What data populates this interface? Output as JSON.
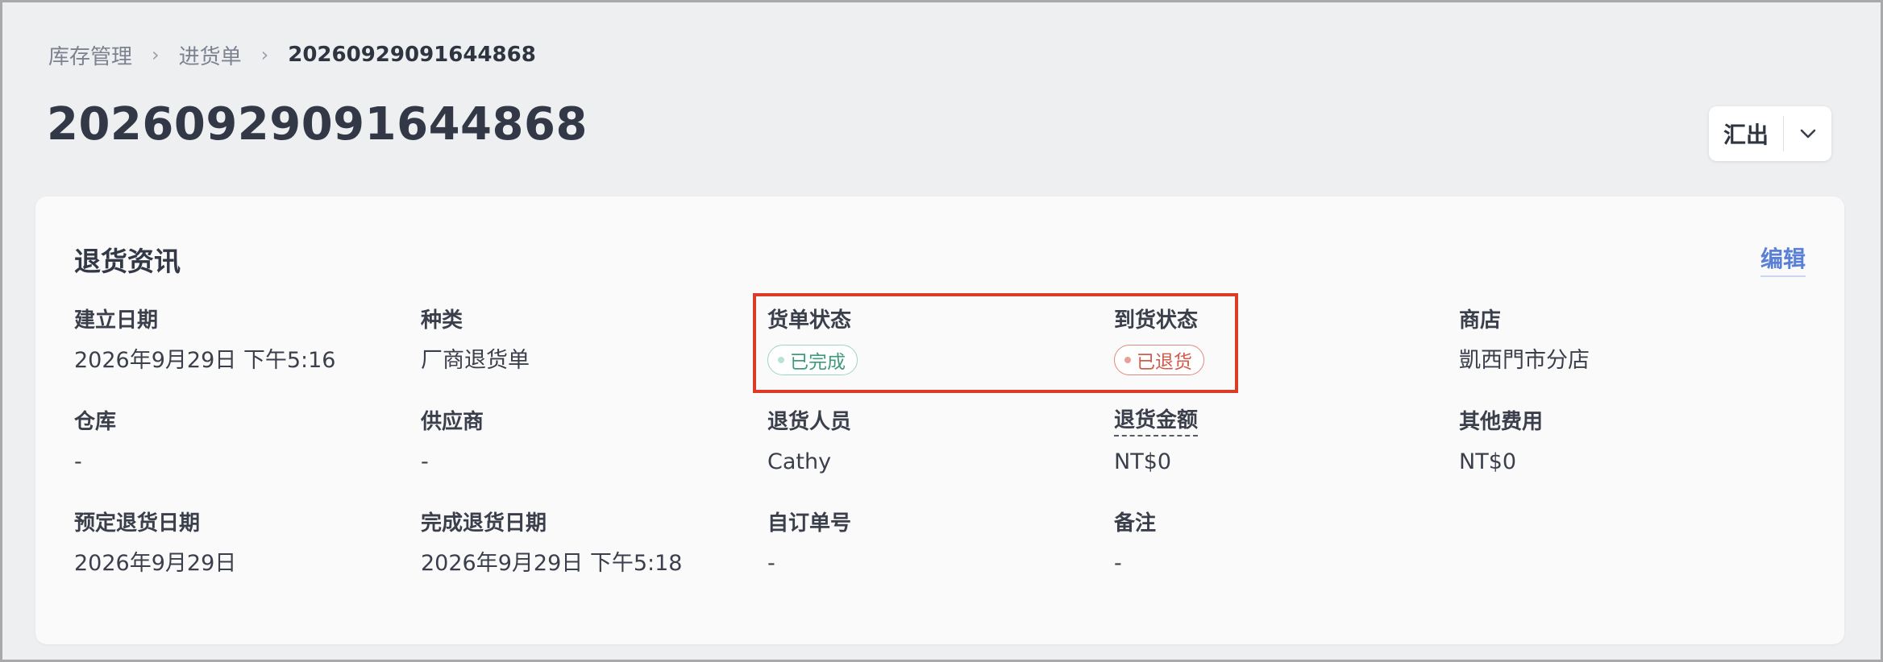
{
  "breadcrumb": {
    "items": [
      "库存管理",
      "进货单"
    ],
    "current": "20260929091644868",
    "separator": "›"
  },
  "page_title": "20260929091644868",
  "export": {
    "label": "汇出",
    "dropdown_icon": "chevron-down-icon"
  },
  "card": {
    "title": "退货资讯",
    "edit_label": "编辑",
    "fields": {
      "created_date": {
        "label": "建立日期",
        "value": "2026年9月29日 下午5:16"
      },
      "type": {
        "label": "种类",
        "value": "厂商退货单"
      },
      "order_status": {
        "label": "货单状态",
        "value": "已完成",
        "color": "#3f9b7a"
      },
      "arrival_status": {
        "label": "到货状态",
        "value": "已退货",
        "color": "#d25b4b"
      },
      "store": {
        "label": "商店",
        "value": "凱西門市分店"
      },
      "warehouse": {
        "label": "仓库",
        "value": "-"
      },
      "supplier": {
        "label": "供应商",
        "value": "-"
      },
      "return_staff": {
        "label": "退货人员",
        "value": "Cathy"
      },
      "return_amount": {
        "label": "退货金额",
        "value": "NT$0"
      },
      "other_fees": {
        "label": "其他费用",
        "value": "NT$0"
      },
      "scheduled_date": {
        "label": "预定退货日期",
        "value": "2026年9月29日"
      },
      "completed_date": {
        "label": "完成退货日期",
        "value": "2026年9月29日 下午5:18"
      },
      "custom_order_no": {
        "label": "自订单号",
        "value": "-"
      },
      "notes": {
        "label": "备注",
        "value": "-"
      }
    }
  },
  "colors": {
    "accent_link": "#5a7fd6",
    "highlight": "#dc3b27",
    "background": "#eeeff1",
    "card": "#fafafa"
  }
}
